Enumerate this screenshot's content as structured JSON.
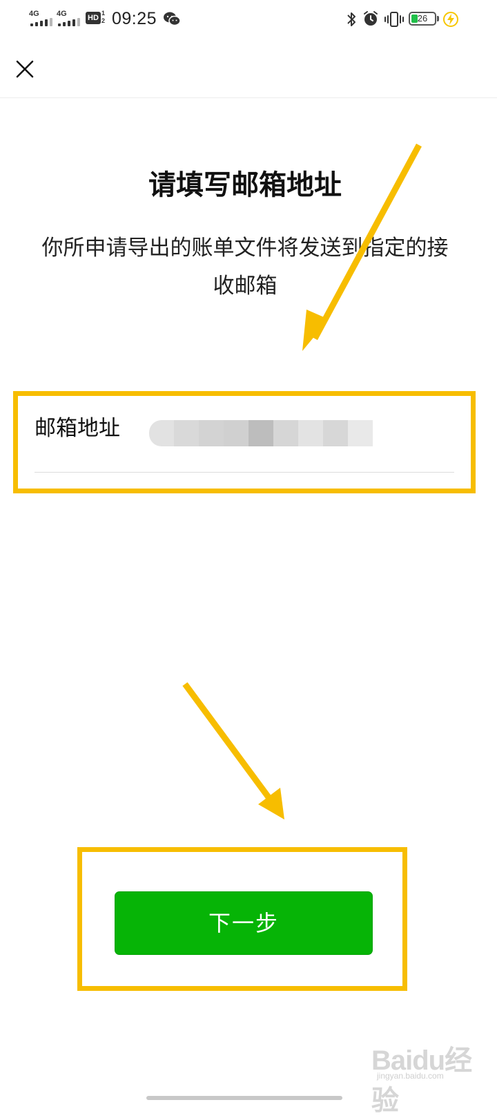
{
  "status_bar": {
    "signal1_label": "4G",
    "signal2_label": "4G",
    "hd_label": "HD",
    "hd_sub": "1\n2",
    "time": "09:25",
    "battery_level": "26",
    "icons": [
      "wechat-icon",
      "bluetooth-icon",
      "alarm-icon",
      "vibrate-icon",
      "battery-icon",
      "charging-icon"
    ]
  },
  "header": {
    "close_icon": "close-icon"
  },
  "main": {
    "title": "请填写邮箱地址",
    "description": "你所申请导出的账单文件将发送到指定的接收邮箱",
    "email_label": "邮箱地址",
    "email_value": ""
  },
  "actions": {
    "next_label": "下一步"
  },
  "watermark": {
    "brand": "Baidu经验",
    "url": "jingyan.baidu.com"
  },
  "colors": {
    "primary_button": "#06b406",
    "highlight": "#f7bd00",
    "arrow": "#f7bd00"
  }
}
